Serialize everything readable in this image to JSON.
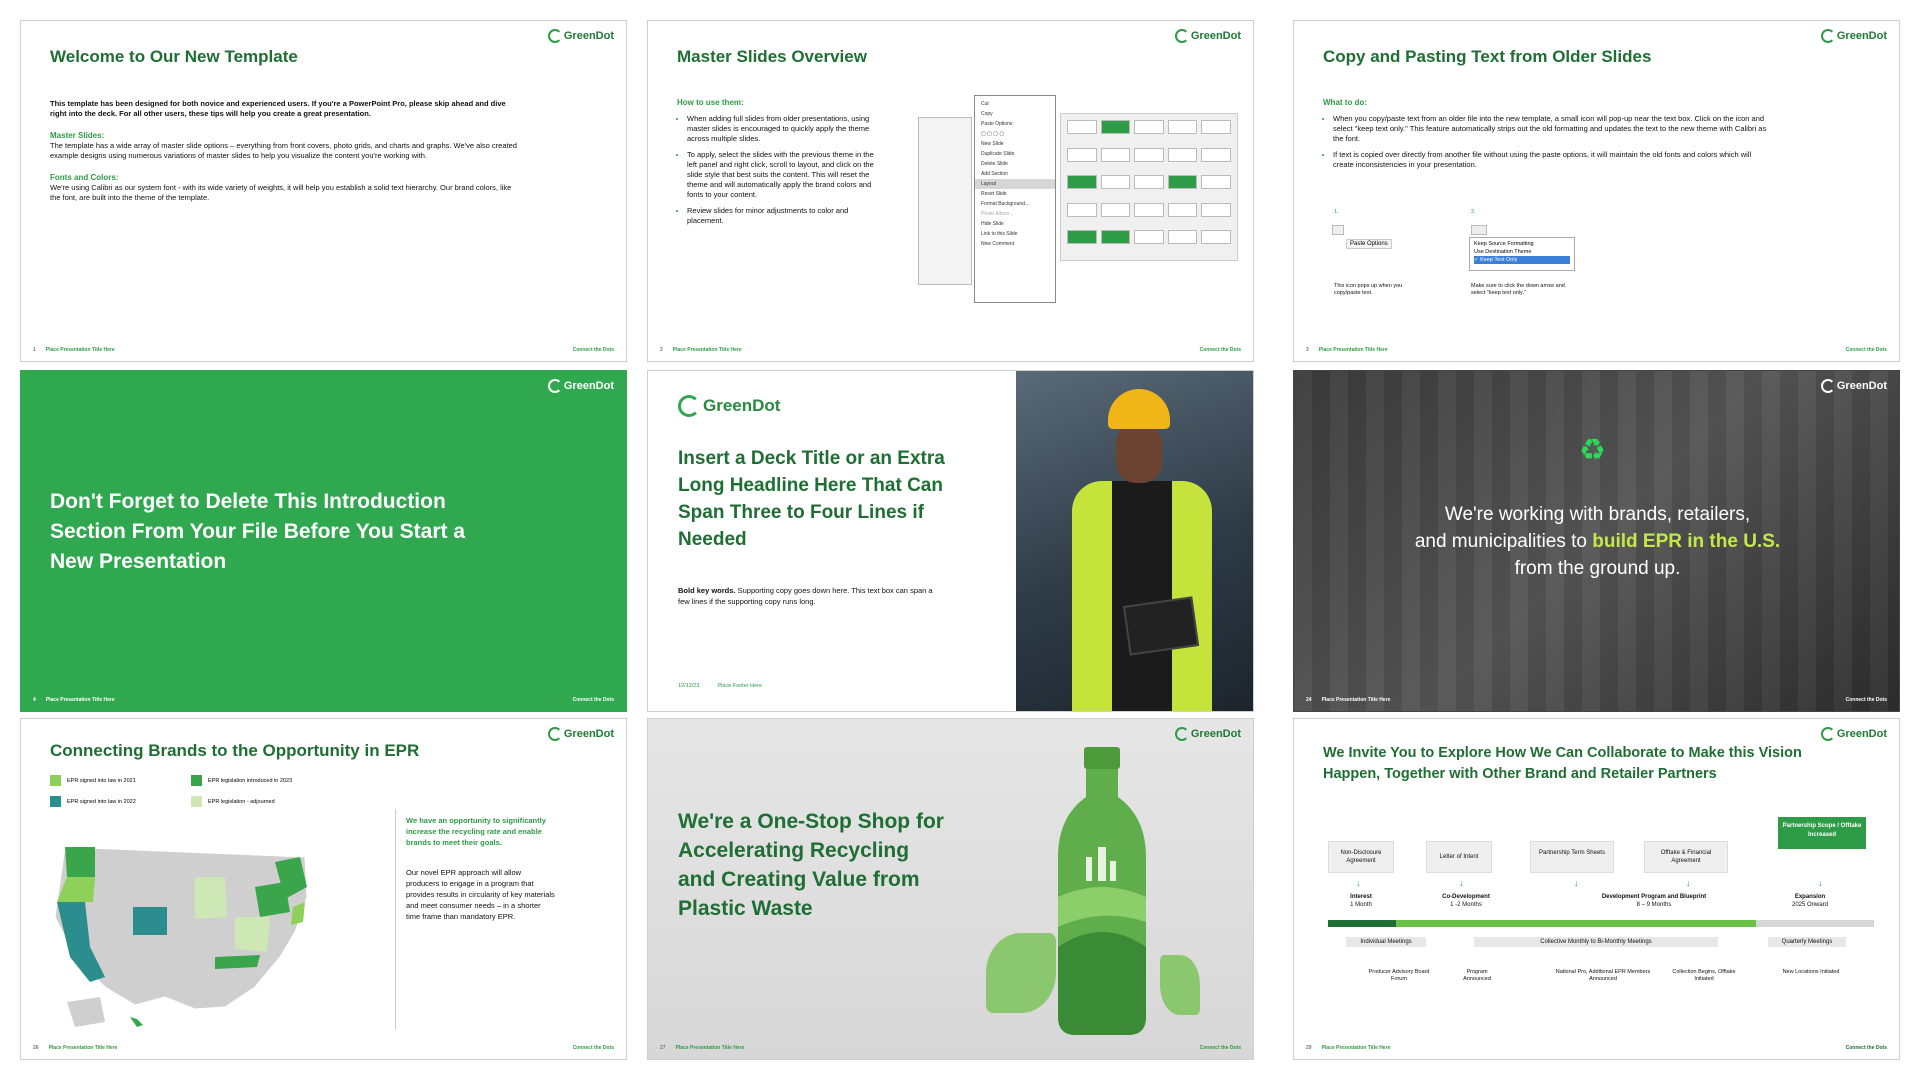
{
  "brand": {
    "name": "GreenDot",
    "accent": "#2e9b46",
    "dark_green": "#1f6e33",
    "highlight": "#c4e84a"
  },
  "footer": {
    "presentation_title": "Place Presentation Title Here",
    "tagline": "Connect the Dots"
  },
  "slides": {
    "s1": {
      "num": "1",
      "title": "Welcome to Our New Template",
      "intro": "This template has been designed for both novice and experienced users. If you're a PowerPoint Pro, please skip ahead and dive right into the deck. For all other users, these tips will help you create a great presentation.",
      "h1": "Master Slides:",
      "p1": "The template has a wide array of master slide options – everything from front covers, photo grids, and charts and graphs. We've also created example designs using numerous variations of master slides to help you visualize the content you're working with.",
      "h2": "Fonts and Colors:",
      "p2": "We're using Calibri as our system font - with its wide variety of weights, it will help you establish a solid text hierarchy. Our brand colors, like the font, are built into the theme of the template."
    },
    "s2": {
      "num": "2",
      "title": "Master Slides Overview",
      "sub": "How to use them:",
      "b1": "When adding full slides from older presentations, using master slides is encouraged to quickly apply the theme across multiple slides.",
      "b2": "To apply, select the slides with the previous theme in the left panel and right click, scroll to layout, and click on the slide style that best suits the content. This will reset the theme and will automatically apply the brand colors and fonts to your content.",
      "b3": "Review slides for minor adjustments to color and placement.",
      "menu": [
        "Cut",
        "Copy",
        "Paste Options:",
        "",
        "New Slide",
        "Duplicate Slide",
        "Delete Slide",
        "Add Section",
        "Layout",
        "Reset Slide",
        "Format Background...",
        "Photo Album...",
        "Hide Slide",
        "Link to this Slide",
        "New Comment"
      ]
    },
    "s3": {
      "num": "3",
      "title": "Copy and Pasting Text from Older Slides",
      "sub": "What to do:",
      "b1": "When you copy/paste text from an older file into the new template, a small icon will pop-up near the text box. Click on the icon and select \"keep text only.\" This feature automatically strips out the old formatting and updates the text to the new theme with Calibri as the font.",
      "b2": "If text is copied over directly from another file without using the paste options, it will maintain the old fonts and colors which will create inconsistencies in your presentation.",
      "step1": "1.",
      "step2": "2.",
      "paste_options": "Paste Options",
      "opt1": "Keep Source Formatting",
      "opt2": "Use Destination Theme",
      "opt3": "✓ Keep Text Only",
      "cap1": "This icon pops up when you copy/paste text.",
      "cap2": "Make sure to click the down arrow and select \"keep text only.\""
    },
    "s4": {
      "num": "4",
      "headline": "Don't Forget to Delete This Introduction Section From Your File Before You Start a New Presentation"
    },
    "s5": {
      "logo": "GreenDot",
      "title": "Insert a Deck Title or an Extra Long Headline Here That Can Span Three to Four Lines if Needed",
      "copy_bold": "Bold key words.",
      "copy": " Supporting copy goes down here. This text box can span a few lines if the supporting copy runs long.",
      "date": "12/12/23",
      "footer": "Place Footer Here"
    },
    "s6": {
      "num": "24",
      "line1": "We're working with brands, retailers,",
      "line2a": "and municipalities to ",
      "line2b": "build EPR in the U.S.",
      "line3": "from the ground up."
    },
    "s7": {
      "num": "26",
      "title": "Connecting Brands to the Opportunity in EPR",
      "legend": [
        {
          "label": "EPR signed into law in 2021",
          "color": "#8ed15a"
        },
        {
          "label": "EPR legislation introduced in 2023",
          "color": "#3aa54b"
        },
        {
          "label": "EPR signed into law in 2022",
          "color": "#2c8d8f"
        },
        {
          "label": "EPR legislation - adjourned",
          "color": "#cde8b5"
        }
      ],
      "green": "We have an opportunity to significantly increase the recycling rate and enable brands to meet their goals.",
      "text": "Our novel EPR approach will allow producers to engage in a program that provides results in circularity of key materials and meet consumer needs – in a shorter time frame than mandatory EPR."
    },
    "s8": {
      "num": "27",
      "title": "We're a One-Stop Shop for Accelerating Recycling and Creating Value from Plastic Waste"
    },
    "s9": {
      "num": "29",
      "title": "We Invite You to Explore How We Can Collaborate to Make this Vision Happen, Together with Other Brand and Retailer Partners",
      "steps": [
        "Non-Disclosure Agreement",
        "Letter of Intent",
        "Partnership Term Sheets",
        "Offtake & Financial Agreement"
      ],
      "scope": "Partnership Scope / Offtake Increased",
      "phases": [
        {
          "name": "Interest",
          "time": "1 Month"
        },
        {
          "name": "Co-Development",
          "time": "1 -2 Months"
        },
        {
          "name": "Development Program and Blueprint",
          "time": "8 – 9 Months"
        },
        {
          "name": "Expansion",
          "time": "2025 Onward"
        }
      ],
      "meetings": [
        "Individual Meetings",
        "Collective Monthly to Bi-Monthly Meetings",
        "Quarterly Meetings"
      ],
      "milestones": [
        "Producer Advisory Board Forum",
        "Program Announced",
        "National Pro, Additional EPR Members Announced",
        "Collection Begins, Offtake Initiated",
        "New Locations Initiated"
      ]
    }
  }
}
